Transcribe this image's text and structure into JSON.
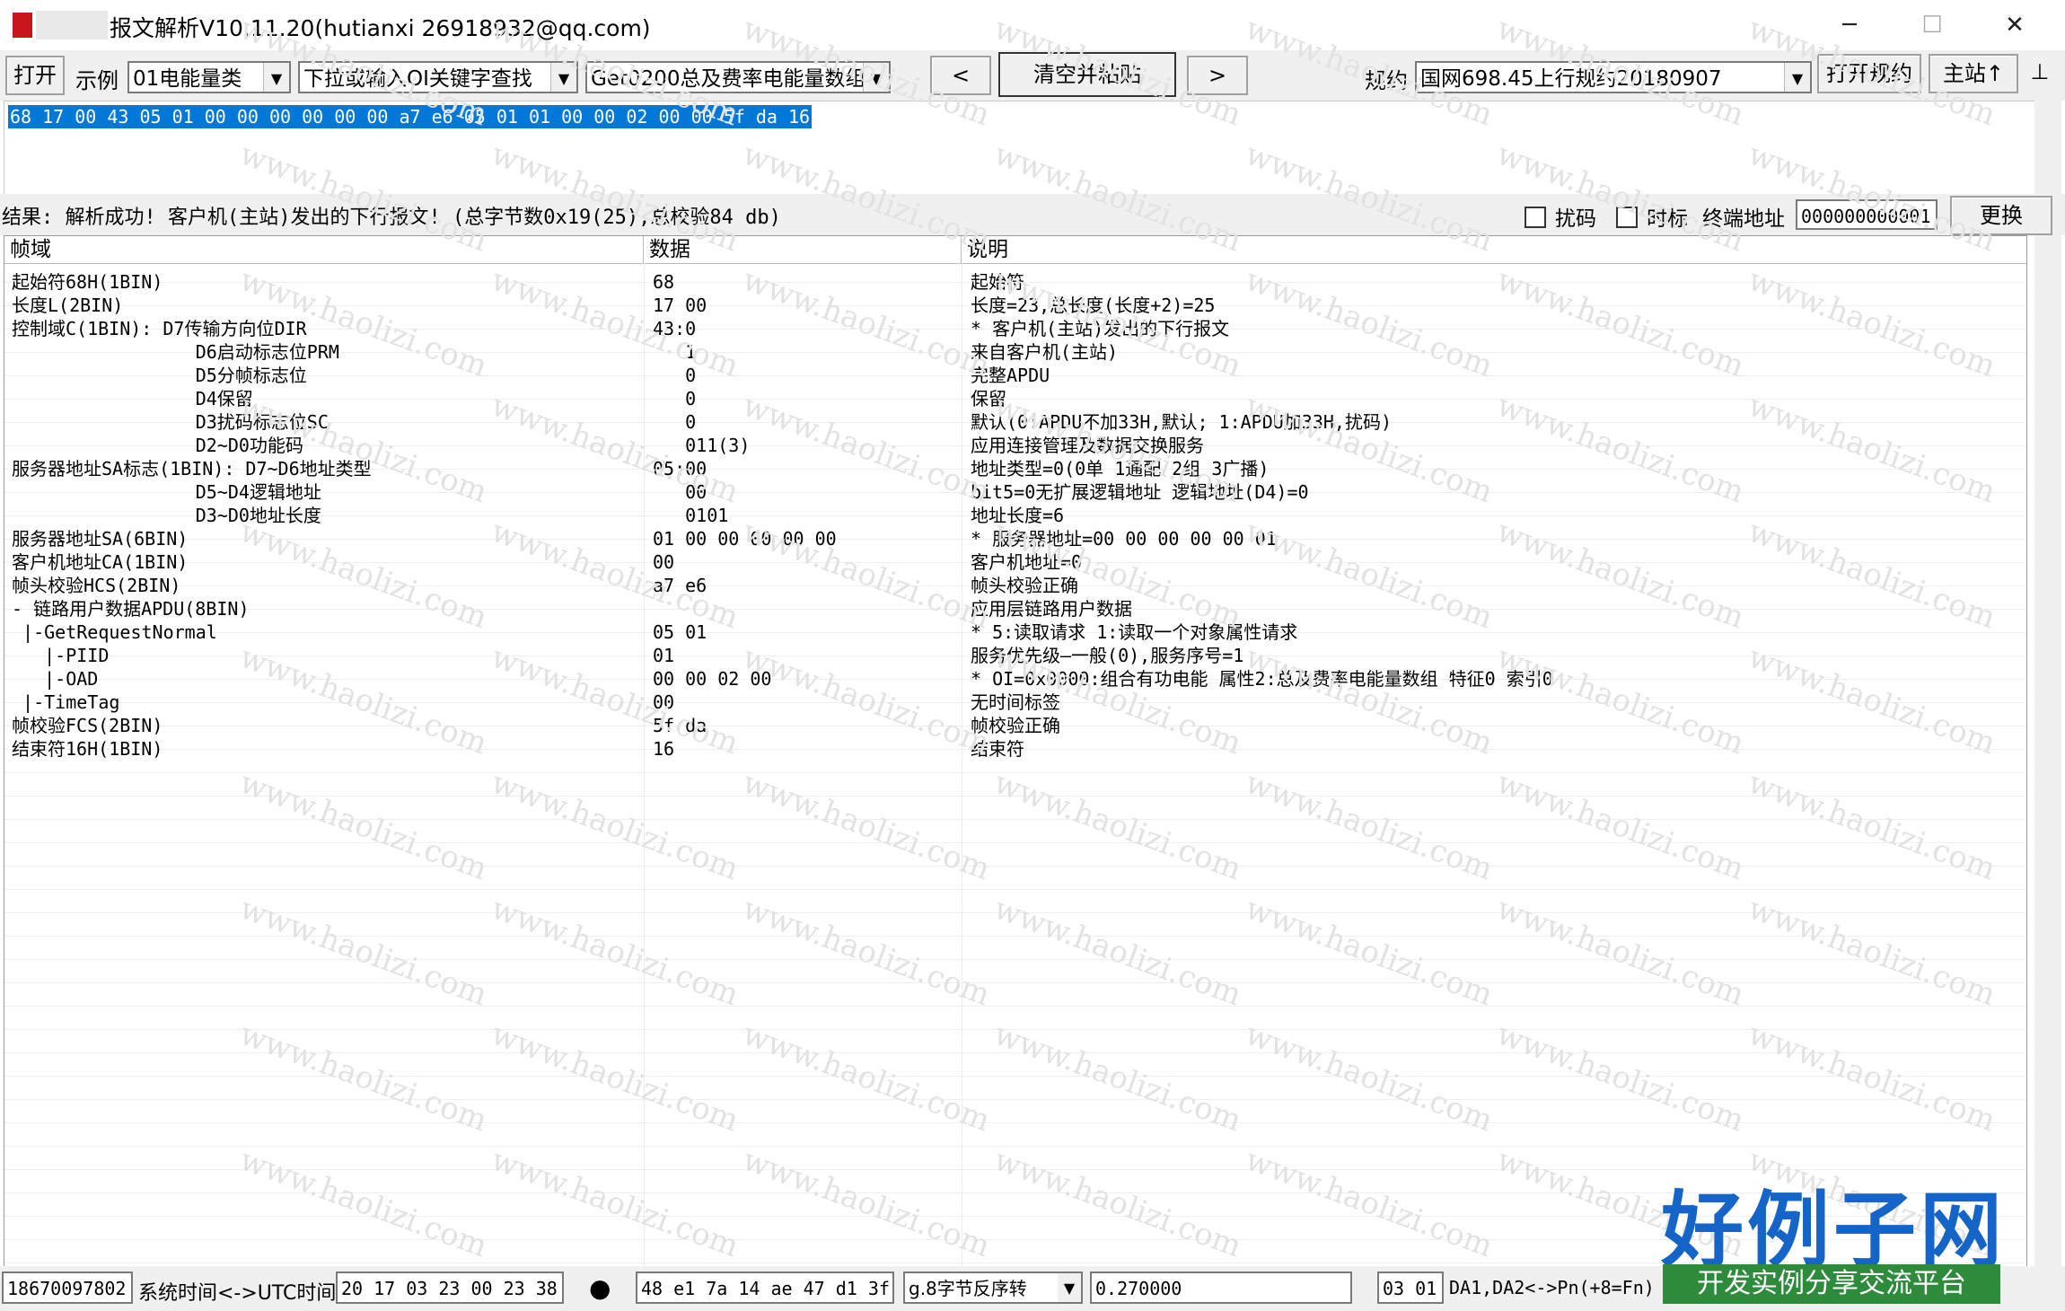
{
  "title": "报文解析V10.11.20(hutianxi 26918932@qq.com)",
  "window_controls": {
    "minimize": "─",
    "maximize": "☐",
    "close": "✕"
  },
  "toolbar": {
    "open_label": "打开",
    "example_label": "示例",
    "example_value": "01电能量类",
    "search_value": "下拉或输入OI关键字查找",
    "template_value": "Get0200总及费率电能量数组",
    "prev_label": "<",
    "clear_paste_label": "清空并粘贴",
    "next_label": ">",
    "protocol_label": "规约",
    "protocol_value": "国网698.45上行规约20180907",
    "open_protocol_label": "打开规约",
    "master_label": "主站↑",
    "extra_label": "⊥"
  },
  "hex_input": "68 17 00 43 05 01 00 00 00 00 00 00 a7 e6 05 01 01 00 00 02 00 00 5f da 16",
  "result": {
    "text": "结果: 解析成功! 客户机(主站)发出的下行报文! (总字节数0x19(25),总校验84 db)",
    "scramble_label": "扰码",
    "timetag_label": "时标",
    "terminal_label": "终端地址",
    "terminal_value": "000000000001",
    "replace_label": "更换"
  },
  "grid": {
    "columns": [
      "帧域",
      "数据",
      "说明"
    ],
    "rows": [
      {
        "field": "起始符68H(1BIN)",
        "data": "68",
        "desc": "起始符"
      },
      {
        "field": "长度L(2BIN)",
        "data": "17 00",
        "desc": "长度=23,总长度(长度+2)=25"
      },
      {
        "field": "控制域C(1BIN): D7传输方向位DIR",
        "data": "43:0",
        "desc": "* 客户机(主站)发出的下行报文"
      },
      {
        "field": "                 D6启动标志位PRM",
        "data": "   1",
        "desc": "来自客户机(主站)"
      },
      {
        "field": "                 D5分帧标志位",
        "data": "   0",
        "desc": "完整APDU"
      },
      {
        "field": "                 D4保留",
        "data": "   0",
        "desc": "保留"
      },
      {
        "field": "                 D3扰码标志位SC",
        "data": "   0",
        "desc": "默认(0:APDU不加33H,默认; 1:APDU加33H,扰码)"
      },
      {
        "field": "                 D2~D0功能码",
        "data": "   011(3)",
        "desc": "应用连接管理及数据交换服务"
      },
      {
        "field": "服务器地址SA标志(1BIN): D7~D6地址类型",
        "data": "05:00",
        "desc": "地址类型=0(0单 1通配 2组 3广播)"
      },
      {
        "field": "                 D5~D4逻辑地址",
        "data": "   00",
        "desc": "bit5=0无扩展逻辑地址 逻辑地址(D4)=0"
      },
      {
        "field": "                 D3~D0地址长度",
        "data": "   0101",
        "desc": "地址长度=6"
      },
      {
        "field": "服务器地址SA(6BIN)",
        "data": "01 00 00 00 00 00",
        "desc": "* 服务器地址=00 00 00 00 00 01"
      },
      {
        "field": "客户机地址CA(1BIN)",
        "data": "00",
        "desc": "客户机地址=0"
      },
      {
        "field": "帧头校验HCS(2BIN)",
        "data": "a7 e6",
        "desc": "帧头校验正确"
      },
      {
        "field": "- 链路用户数据APDU(8BIN)",
        "data": "",
        "desc": "应用层链路用户数据"
      },
      {
        "field": " |-GetRequestNormal",
        "data": "05 01",
        "desc": "* 5:读取请求 1:读取一个对象属性请求"
      },
      {
        "field": "   |-PIID",
        "data": "01",
        "desc": "服务优先级—一般(0),服务序号=1"
      },
      {
        "field": "   |-OAD",
        "data": "00 00 02 00",
        "desc": "* OI=0x0000:组合有功电能 属性2:总及费率电能量数组 特征0 索引0"
      },
      {
        "field": " |-TimeTag",
        "data": "00",
        "desc": "无时间标签"
      },
      {
        "field": "帧校验FCS(2BIN)",
        "data": "5f da",
        "desc": "帧校验正确"
      },
      {
        "field": "结束符16H(1BIN)",
        "data": "16",
        "desc": "结束符"
      }
    ]
  },
  "status": {
    "phone": "18670097802",
    "time_conv_label": "系统时间<->UTC时间",
    "time_value": "20 17 03 23 00 23 38",
    "dot": "●",
    "bytes_value": "48 e1 7a 14 ae 47 d1 3f",
    "conv_mode": "g.8字节反序转",
    "float_value": "0.270000",
    "da_value": "03 01",
    "da_label": "DA1,DA2<->Pn(+8=Fn)"
  },
  "watermark": "www.haolizi.com",
  "brand": {
    "name": "好例子网",
    "tagline": "开发实例分享交流平台",
    "color": "#1565c8",
    "tag_bg": "#2e8b3c"
  }
}
